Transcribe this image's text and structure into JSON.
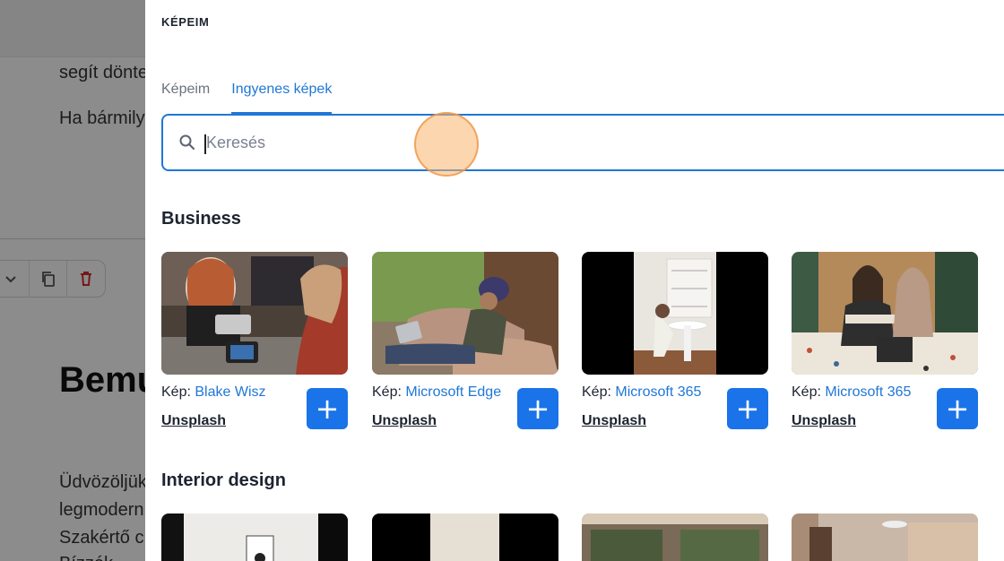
{
  "background": {
    "lines": [
      "segít dönte",
      "Ha bármily",
      "Üdvözöljük",
      "legmodern",
      "Szakértő c",
      "Bízzék"
    ],
    "heading": "Bemu"
  },
  "panel": {
    "title": "KÉPEIM",
    "tabs": [
      {
        "label": "Képeim",
        "active": false
      },
      {
        "label": "Ingyenes képek",
        "active": true
      }
    ],
    "search": {
      "placeholder": "Keresés",
      "value": ""
    },
    "sections": [
      {
        "title": "Business",
        "cards": [
          {
            "prefix": "Kép:",
            "author": "Blake Wisz",
            "source": "Unsplash",
            "add": "+"
          },
          {
            "prefix": "Kép:",
            "author": "Microsoft Edge",
            "source": "Unsplash",
            "add": "+"
          },
          {
            "prefix": "Kép:",
            "author": "Microsoft 365",
            "source": "Unsplash",
            "add": "+"
          },
          {
            "prefix": "Kép:",
            "author": "Microsoft 365",
            "source": "Unsplash",
            "add": "+"
          }
        ]
      },
      {
        "title": "Interior design"
      }
    ]
  },
  "colors": {
    "accent": "#1f77d6",
    "add_button": "#1a73e8",
    "delete_icon": "#d32f2f"
  }
}
